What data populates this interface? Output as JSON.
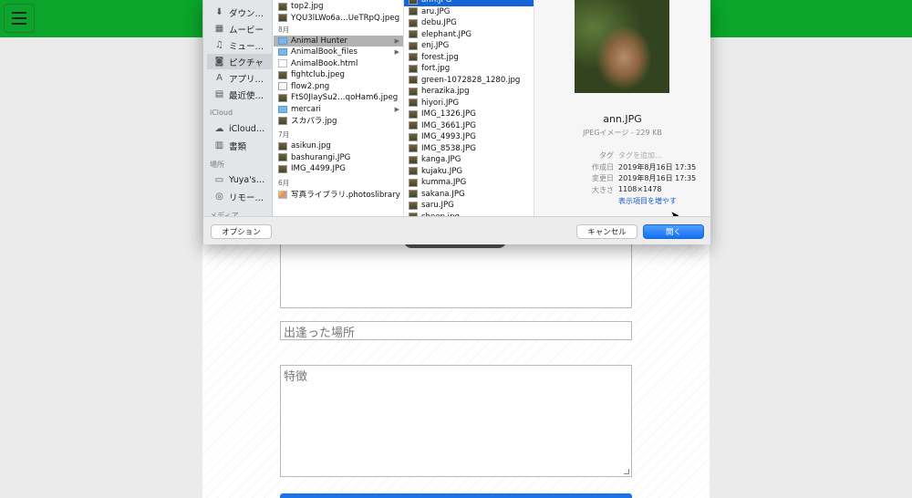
{
  "sidebar": {
    "favorites": [
      {
        "label": "ダウン…",
        "icon": "download-icon"
      },
      {
        "label": "ムービー",
        "icon": "film-icon"
      },
      {
        "label": "ミュー…",
        "icon": "music-icon"
      },
      {
        "label": "ピクチャ",
        "icon": "camera-icon",
        "selected": true
      },
      {
        "label": "アプリ…",
        "icon": "apps-icon"
      },
      {
        "label": "最近使…",
        "icon": "recent-icon"
      }
    ],
    "icloud_heading": "iCloud",
    "icloud": [
      {
        "label": "iCloud…",
        "icon": "cloud-icon"
      },
      {
        "label": "書類",
        "icon": "document-icon"
      }
    ],
    "places_heading": "場所",
    "places": [
      {
        "label": "Yuya's…",
        "icon": "laptop-icon"
      },
      {
        "label": "リモー…",
        "icon": "disc-icon"
      }
    ],
    "media_heading": "メディア"
  },
  "col1": {
    "rows": [
      {
        "label": "top2.jpg",
        "type": "img"
      },
      {
        "label": "YQU3lLWo6a…UeTRpQ.jpeg",
        "type": "img"
      },
      {
        "label": "8月",
        "type": "header"
      },
      {
        "label": "Animal Hunter",
        "type": "folder",
        "selected": true,
        "arrow": "▶"
      },
      {
        "label": "AnimalBook_files",
        "type": "folder",
        "arrow": "▶"
      },
      {
        "label": "AnimalBook.html",
        "type": "html"
      },
      {
        "label": "fightclub.jpeg",
        "type": "img"
      },
      {
        "label": "flow2.png",
        "type": "doc"
      },
      {
        "label": "FtS0JIaySu2…qoHam6.jpeg",
        "type": "img"
      },
      {
        "label": "mercari",
        "type": "folder",
        "arrow": "▶"
      },
      {
        "label": "スカパラ.jpg",
        "type": "img"
      },
      {
        "label": "",
        "type": "spacer"
      },
      {
        "label": "7月",
        "type": "header"
      },
      {
        "label": "asikun.jpg",
        "type": "img"
      },
      {
        "label": "bashurangi.JPG",
        "type": "img"
      },
      {
        "label": "IMG_4499.JPG",
        "type": "img"
      },
      {
        "label": "",
        "type": "spacer"
      },
      {
        "label": "6月",
        "type": "header"
      },
      {
        "label": "写真ライブラリ.photoslibrary",
        "type": "lib"
      }
    ]
  },
  "col2": {
    "rows": [
      {
        "label": "ann.JPG",
        "active": true
      },
      {
        "label": "aru.JPG"
      },
      {
        "label": "debu.JPG"
      },
      {
        "label": "elephant.JPG"
      },
      {
        "label": "enj.JPG"
      },
      {
        "label": "forest.jpg"
      },
      {
        "label": "fort.jpg"
      },
      {
        "label": "green-1072828_1280.jpg"
      },
      {
        "label": "herazika.jpg"
      },
      {
        "label": "hiyori.JPG"
      },
      {
        "label": "IMG_1326.JPG"
      },
      {
        "label": "IMG_3661.JPG"
      },
      {
        "label": "IMG_4993.JPG"
      },
      {
        "label": "IMG_8538.JPG"
      },
      {
        "label": "kanga.JPG"
      },
      {
        "label": "kujaku.JPG"
      },
      {
        "label": "kumma.JPG"
      },
      {
        "label": "sakana.JPG"
      },
      {
        "label": "saru.JPG"
      },
      {
        "label": "sheep.jpg"
      }
    ]
  },
  "preview": {
    "name": "ann.JPG",
    "kind": "JPEGイメージ - 229 KB",
    "meta": [
      {
        "key": "タグ",
        "value": "タグを追加…",
        "muted": true
      },
      {
        "key": "作成日",
        "value": "2019年8月16日 17:35"
      },
      {
        "key": "変更日",
        "value": "2019年8月16日 17:35"
      },
      {
        "key": "大きさ",
        "value": "1108×1478"
      }
    ],
    "more_link": "表示項目を増やす"
  },
  "footer": {
    "options": "オプション",
    "cancel": "キャンセル",
    "open": "開く"
  },
  "form": {
    "place_placeholder": "出逢った場所",
    "features_placeholder": "特徴"
  }
}
